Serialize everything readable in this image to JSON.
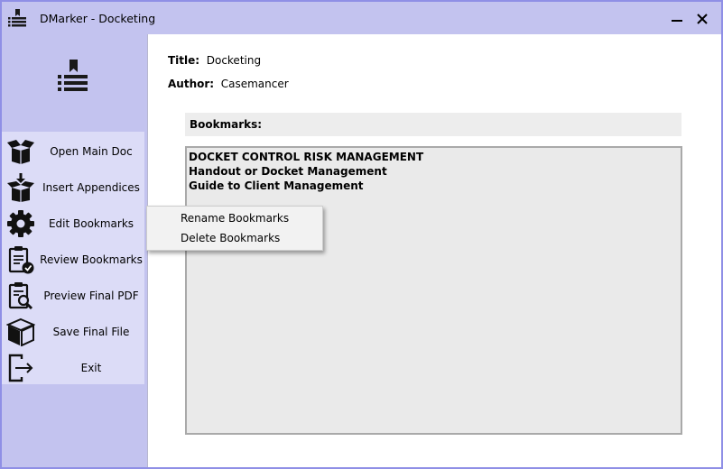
{
  "window": {
    "title": "DMarker - Docketing",
    "accent_color": "#c3c3ef",
    "border_color": "#8f8fe6",
    "icons": {
      "app": "bookmark-list-icon",
      "minimize": "minimize-icon",
      "close": "close-icon"
    }
  },
  "sidebar": {
    "logo_icon": "bookmark-list-icon",
    "panel_color": "#dcdcf7",
    "items": [
      {
        "label": "Open Main Doc",
        "icon": "open-box-icon"
      },
      {
        "label": "Insert Appendices",
        "icon": "box-insert-icon"
      },
      {
        "label": "Edit Bookmarks",
        "icon": "gear-icon"
      },
      {
        "label": "Review Bookmarks",
        "icon": "clipboard-check-icon"
      },
      {
        "label": "Preview Final PDF",
        "icon": "clipboard-search-icon"
      },
      {
        "label": "Save Final File",
        "icon": "box-icon"
      },
      {
        "label": "Exit",
        "icon": "exit-icon"
      }
    ]
  },
  "document": {
    "title_label": "Title:",
    "title_value": "Docketing",
    "author_label": "Author:",
    "author_value": "Casemancer"
  },
  "bookmarks": {
    "header": "Bookmarks:",
    "items": [
      "DOCKET CONTROL RISK MANAGEMENT",
      "Handout or Docket Management",
      "Guide to Client Management"
    ]
  },
  "context_menu": {
    "items": [
      "Rename Bookmarks",
      "Delete Bookmarks"
    ]
  }
}
